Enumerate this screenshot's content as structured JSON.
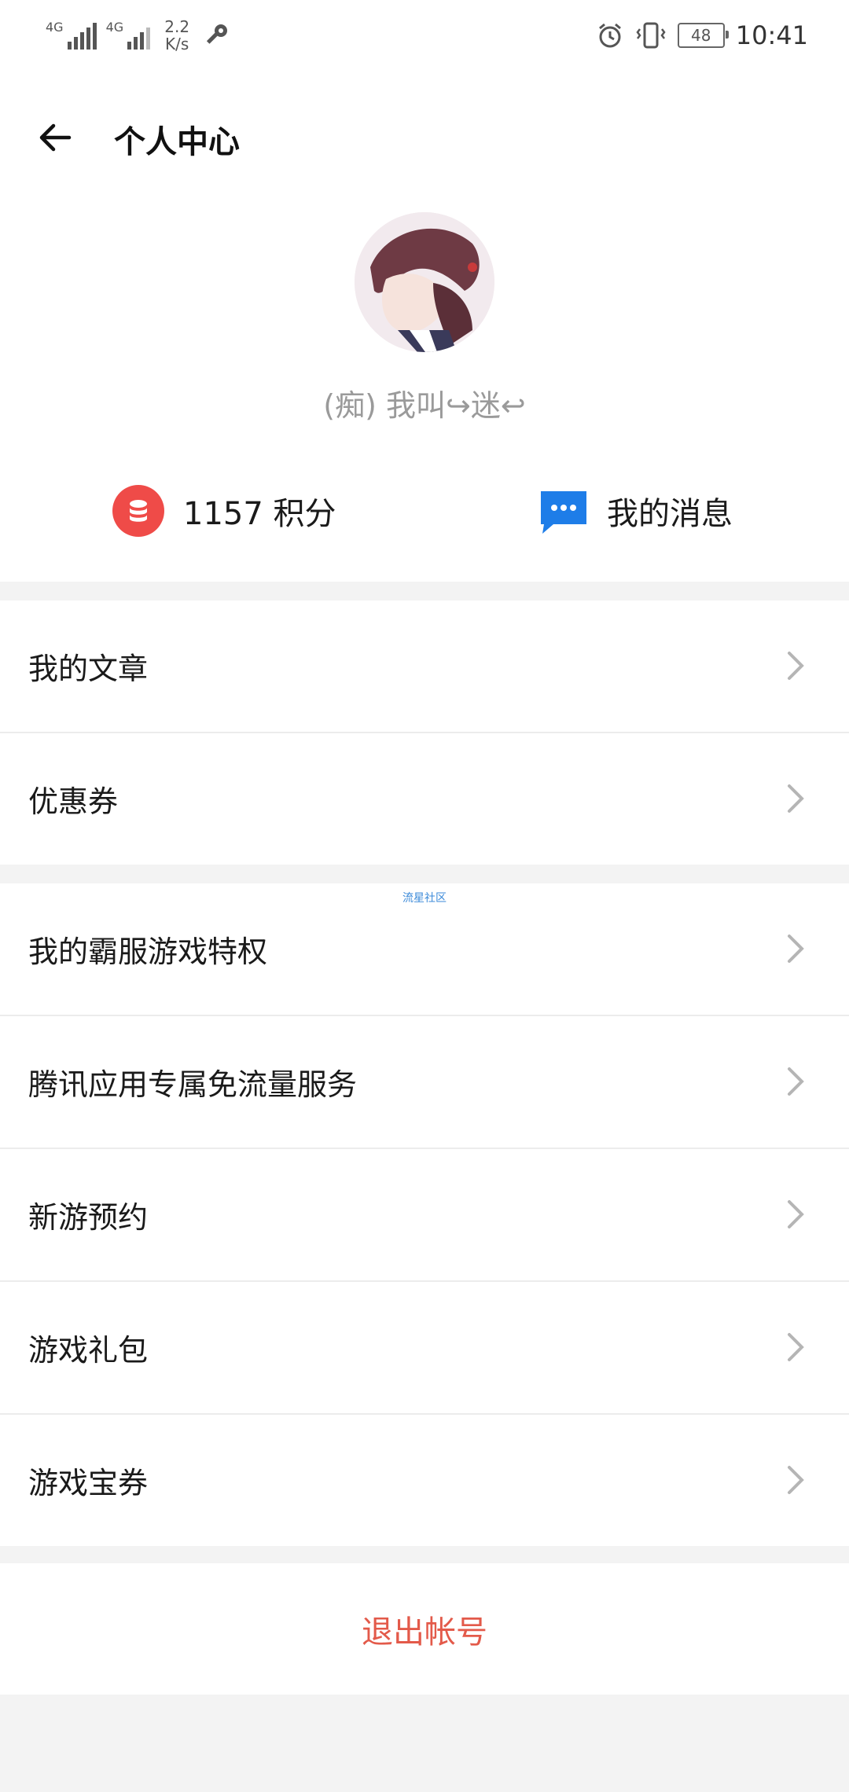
{
  "status_bar": {
    "network_1": "4G",
    "network_2": "4G",
    "speed_value": "2.2",
    "speed_unit": "K/s",
    "battery": "48",
    "time": "10:41"
  },
  "header": {
    "title": "个人中心",
    "back_icon": "arrow-left-icon"
  },
  "profile": {
    "nickname": "(痴) 我叫↪迷↩",
    "points_text": "1157 积分",
    "messages_text": "我的消息",
    "points_icon": "coin-stack-icon",
    "messages_icon": "chat-bubble-icon"
  },
  "menu_group_1": [
    {
      "label": "我的文章"
    },
    {
      "label": "优惠券"
    }
  ],
  "menu_group_2": {
    "ad_tag": "流星社区",
    "items": [
      {
        "label": "我的霸服游戏特权"
      },
      {
        "label": "腾讯应用专属免流量服务"
      },
      {
        "label": "新游预约"
      },
      {
        "label": "游戏礼包"
      },
      {
        "label": "游戏宝券"
      }
    ]
  },
  "logout": {
    "label": "退出帐号"
  },
  "colors": {
    "accent_red": "#ef4b48",
    "accent_blue": "#1e7de8",
    "logout_red": "#e35a4a",
    "background": "#f3f3f3"
  }
}
